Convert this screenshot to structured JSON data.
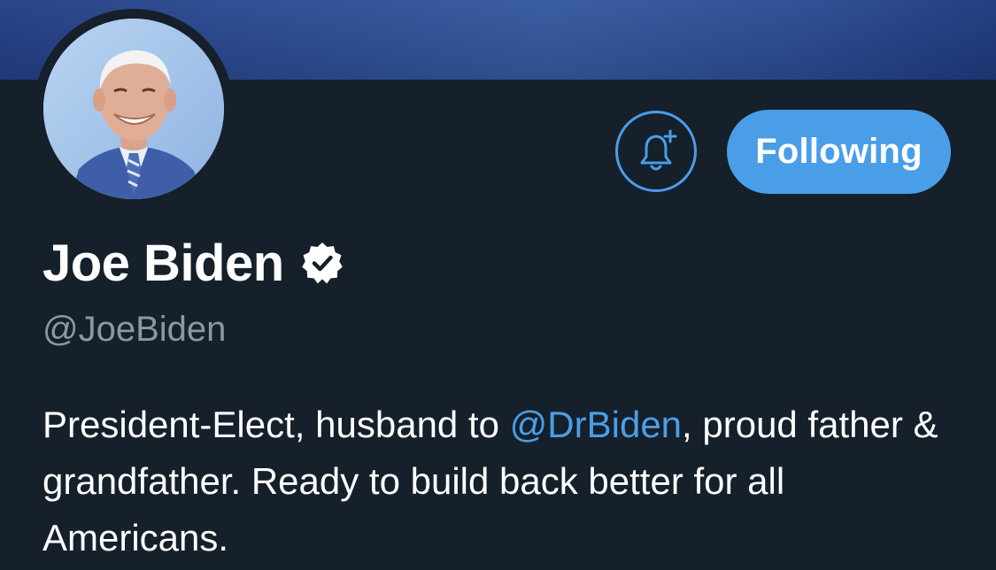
{
  "profile": {
    "display_name": "Joe Biden",
    "handle": "@JoeBiden",
    "verified": true,
    "bio_before_mention": "President-Elect, husband to ",
    "bio_mention": "@DrBiden",
    "bio_after_mention": ", proud father & grandfather. Ready to build back better for all Americans."
  },
  "actions": {
    "notifications_icon": "bell-plus-icon",
    "following_label": "Following"
  },
  "colors": {
    "background": "#15202b",
    "accent": "#4a9ee8",
    "secondary_text": "#8899a6",
    "primary_text": "#ffffff"
  }
}
